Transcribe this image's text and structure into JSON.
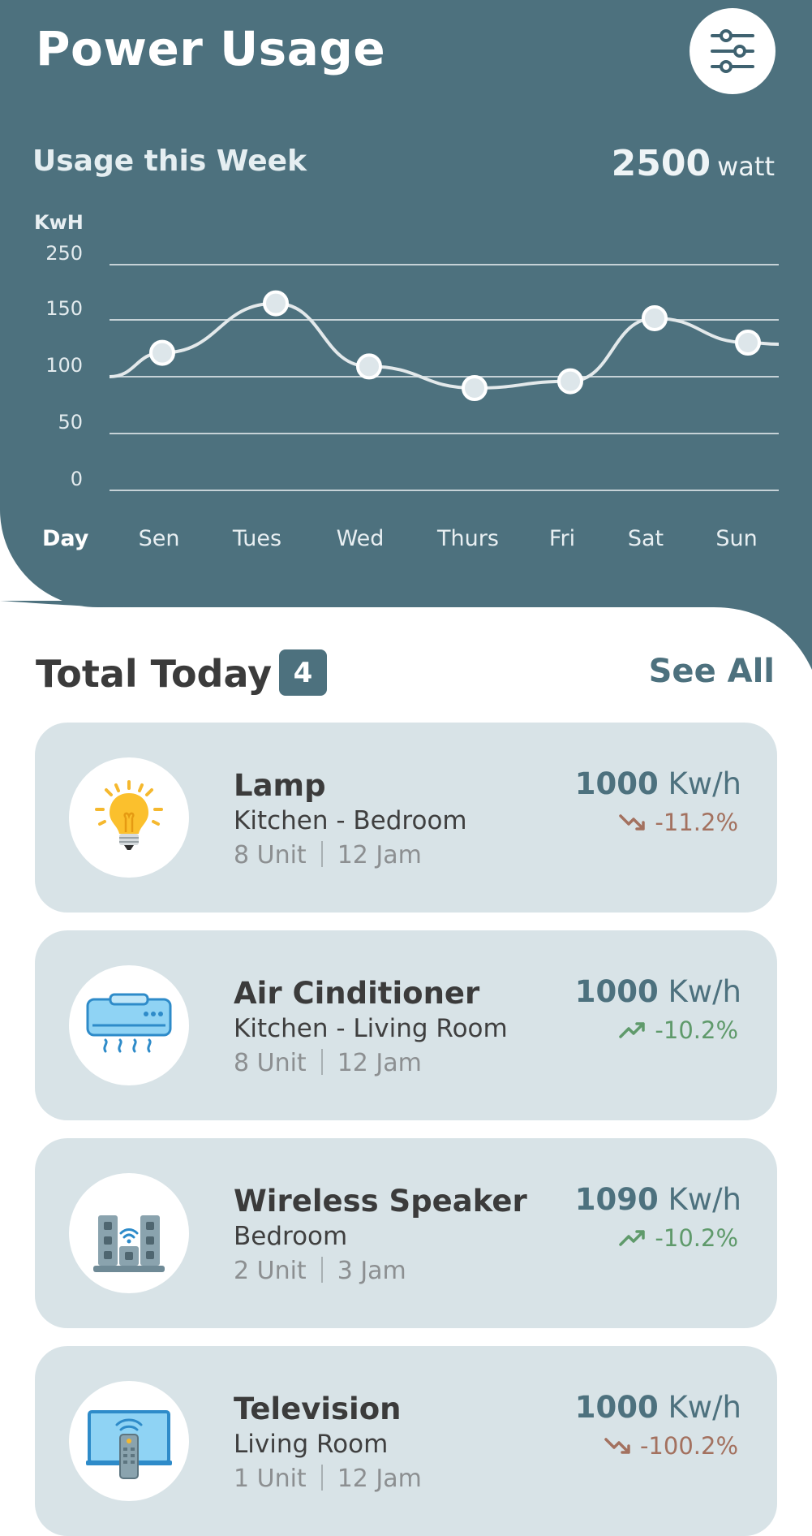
{
  "header": {
    "title": "Power Usage",
    "subtitle": "Usage this Week",
    "total_value": "2500",
    "total_unit": "watt"
  },
  "chart_data": {
    "type": "line",
    "title": "Usage this Week",
    "ylabel": "KwH",
    "xlabel": "Day",
    "categories": [
      "Sen",
      "Tues",
      "Wed",
      "Thurs",
      "Fri",
      "Sat",
      "Sun"
    ],
    "y_ticks": [
      "250",
      "150",
      "100",
      "50",
      "0"
    ],
    "values": [
      121,
      180,
      109,
      90,
      96,
      153,
      130
    ],
    "ylim": [
      0,
      250
    ],
    "grid": true,
    "colors": {
      "line": "#e3e9eb",
      "grid": "#c6d2d7",
      "point_fill": "#dde6ea"
    }
  },
  "section": {
    "title": "Total Today",
    "count": "4",
    "see_all": "See All"
  },
  "devices": [
    {
      "name": "Lamp",
      "location": "Kitchen - Bedroom",
      "units": "8 Unit",
      "hours": "12 Jam",
      "power_value": "1000",
      "power_unit": "Kw/h",
      "trend": "-11.2%",
      "trend_dir": "down",
      "icon": "lightbulb-icon"
    },
    {
      "name": "Air Cinditioner",
      "location": "Kitchen - Living Room",
      "units": "8 Unit",
      "hours": "12 Jam",
      "power_value": "1000",
      "power_unit": "Kw/h",
      "trend": "-10.2%",
      "trend_dir": "up",
      "icon": "air-conditioner-icon"
    },
    {
      "name": "Wireless Speaker",
      "location": "Bedroom",
      "units": "2 Unit",
      "hours": "3 Jam",
      "power_value": "1090",
      "power_unit": "Kw/h",
      "trend": "-10.2%",
      "trend_dir": "up",
      "icon": "speaker-icon"
    },
    {
      "name": "Television",
      "location": "Living Room",
      "units": "1 Unit",
      "hours": "12 Jam",
      "power_value": "1000",
      "power_unit": "Kw/h",
      "trend": "-100.2%",
      "trend_dir": "down",
      "icon": "television-icon"
    }
  ],
  "colors": {
    "primary": "#4d717e",
    "card_bg": "#d8e3e7",
    "trend_down": "#a3715f",
    "trend_up": "#5f9a6b"
  }
}
